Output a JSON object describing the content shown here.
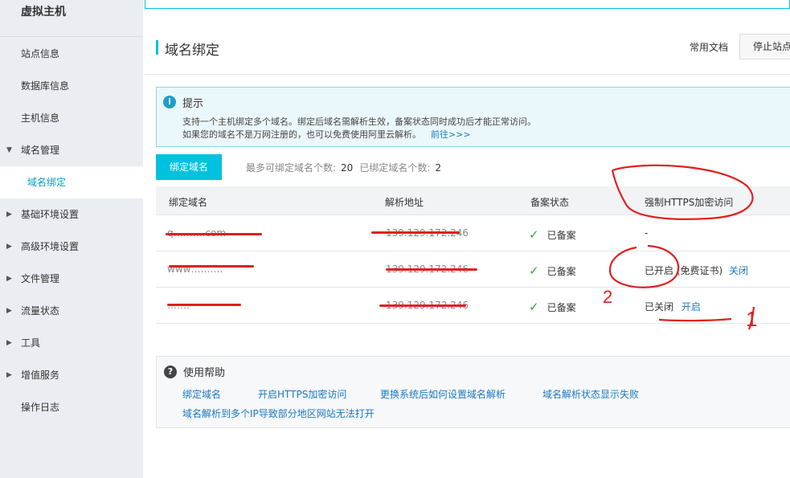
{
  "sidebar": {
    "brand": "虚拟主机",
    "items": [
      {
        "label": "站点信息"
      },
      {
        "label": "数据库信息"
      },
      {
        "label": "主机信息"
      },
      {
        "label": "域名管理"
      },
      {
        "label": "域名绑定"
      },
      {
        "label": "基础环境设置"
      },
      {
        "label": "高级环境设置"
      },
      {
        "label": "文件管理"
      },
      {
        "label": "流量状态"
      },
      {
        "label": "工具"
      },
      {
        "label": "增值服务"
      },
      {
        "label": "操作日志"
      }
    ]
  },
  "header": {
    "title": "域名绑定",
    "doc_link": "常用文档",
    "stop_button": "停止站点"
  },
  "tip": {
    "title": "提示",
    "line1": "支持一个主机绑定多个域名。绑定后域名需解析生效，备案状态同时成功后才能正常访问。",
    "line2": "如果您的域名不是万网注册的，也可以免费使用阿里云解析。",
    "more": "前往>>>"
  },
  "bind": {
    "button": "绑定域名",
    "max_label": "最多可绑定域名个数:",
    "max_value": "20",
    "bound_label": "已绑定域名个数:",
    "bound_value": "2"
  },
  "table": {
    "headers": [
      "绑定域名",
      "解析地址",
      "备案状态",
      "强制HTTPS加密访问"
    ],
    "rows": [
      {
        "domain": "q……….com",
        "ip": "139.129.172.246",
        "status": "已备案",
        "https_state": "-",
        "https_extra": "",
        "https_action": ""
      },
      {
        "domain": "www……….",
        "ip": "139.129.172.246",
        "status": "已备案",
        "https_state": "已开启",
        "https_extra": "(免费证书)",
        "https_action": "关闭"
      },
      {
        "domain": "…….",
        "ip": "139.129.172.246",
        "status": "已备案",
        "https_state": "已关闭",
        "https_extra": "",
        "https_action": "开启"
      }
    ]
  },
  "help": {
    "title": "使用帮助",
    "links": [
      "绑定域名",
      "开启HTTPS加密访问",
      "更换系统后如何设置域名解析",
      "域名解析状态显示失败",
      "域名解析到多个IP导致部分地区网站无法打开"
    ]
  },
  "annotations": {
    "label_2": "2",
    "label_1": "1"
  },
  "colors": {
    "accent": "#00c1de",
    "link": "#1a78c2",
    "annotation": "#e02020",
    "check": "#3aa845"
  }
}
